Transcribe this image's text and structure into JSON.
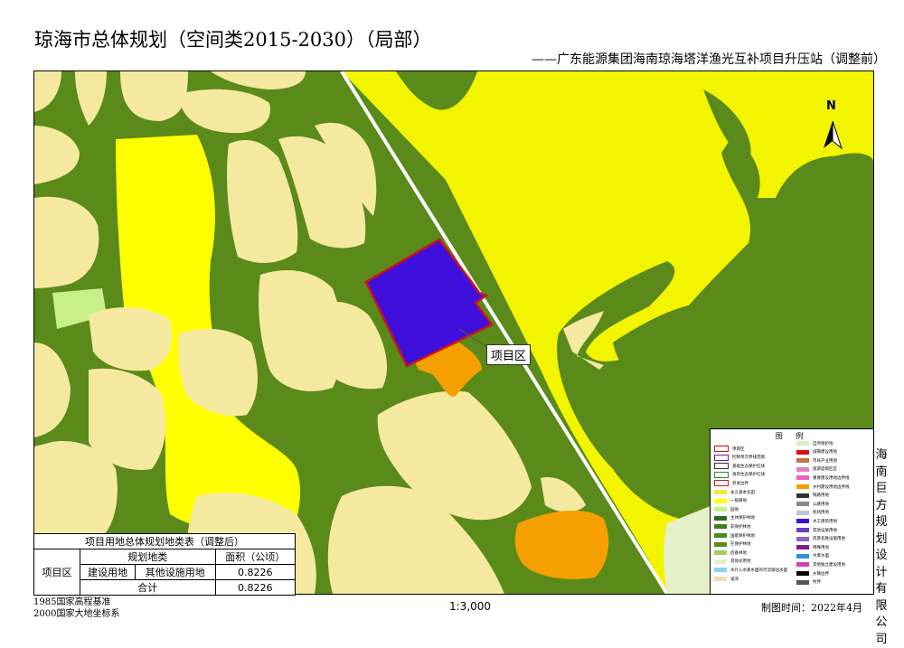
{
  "title": "琼海市总体规划（空间类2015-2030）（局部）",
  "subtitle": "——广东能源集团海南琼海塔洋渔光互补项目升压站（调整前）",
  "north_label": "N",
  "callout_label": "项目区",
  "company": "海南巨方规划设计有限公司",
  "datum_lines": [
    "1985国家高程基准",
    "2000国家大地坐标系"
  ],
  "scale": "1:3,000",
  "date": "制图时间：2022年4月",
  "table": {
    "title": "项目用地总体规划地类表（调整后）",
    "col_category": "规划地类",
    "col_area": "面积（公顷）",
    "row_header": "项目区",
    "rows": [
      {
        "cat1": "建设用地",
        "cat2": "其他设施用地",
        "area": "0.8226"
      }
    ],
    "total_label": "合计",
    "total_area": "0.8226"
  },
  "legend": {
    "title": "图 例",
    "left": [
      {
        "label": "项目区",
        "color": "#ffffff",
        "border": "#d0101a"
      },
      {
        "label": "控制单元界线范围",
        "color": "#ffffff",
        "border": "#6a1aa0"
      },
      {
        "label": "基础生态保护红线",
        "color": "#ffffff",
        "border": "#333333"
      },
      {
        "label": "海岸生态保护红线",
        "color": "#ffffff",
        "border": "#2a8a2a"
      },
      {
        "label": "开发边界",
        "color": "#ffffff",
        "border": "#c02020"
      },
      {
        "label": "永久基本农田",
        "color": "#f5e640"
      },
      {
        "label": "一般耕地",
        "color": "#ffff00"
      },
      {
        "label": "园地",
        "color": "#c8f08a"
      },
      {
        "label": "主体保护林地",
        "color": "#2f6b1a"
      },
      {
        "label": "非保护林地",
        "color": "#3f7d1f"
      },
      {
        "label": "国家保护林地",
        "color": "#4a8a22"
      },
      {
        "label": "在保护林地",
        "color": "#5a8a1a"
      },
      {
        "label": "后备林地",
        "color": "#9ed060"
      },
      {
        "label": "其他农用地",
        "color": "#e6f0c8"
      },
      {
        "label": "水计入水库水面的河流湖泊水面",
        "color": "#8fd0f0"
      },
      {
        "label": "滩涂",
        "color": "#f3dcb0"
      }
    ],
    "right": [
      {
        "label": "自然保护地",
        "color": "#d8f0c0"
      },
      {
        "label": "城镇建设用地",
        "color": "#e01010"
      },
      {
        "label": "市县产业用地",
        "color": "#b87a4a"
      },
      {
        "label": "旅游度假区区",
        "color": "#e080c0"
      },
      {
        "label": "重要建设用地边界线",
        "color": "#f060c0"
      },
      {
        "label": "乡村建设用地边界线",
        "color": "#f5a000"
      },
      {
        "label": "铁路用地",
        "color": "#333333"
      },
      {
        "label": "公路用地",
        "color": "#888888"
      },
      {
        "label": "机场用地",
        "color": "#b8c8e0"
      },
      {
        "label": "水工建筑用地",
        "color": "#3a10d0"
      },
      {
        "label": "其他设施用地",
        "color": "#6a40c0"
      },
      {
        "label": "风景名胜设施用地",
        "color": "#9060c0"
      },
      {
        "label": "特殊用地",
        "color": "#7a2080"
      },
      {
        "label": "水库水面",
        "color": "#3090e0"
      },
      {
        "label": "其他独立建设用地",
        "color": "#d040c0"
      },
      {
        "label": "乡镇边界",
        "color": "#000000"
      },
      {
        "label": "村界",
        "color": "#555555"
      }
    ]
  },
  "colors": {
    "forest": "#5a8a1a",
    "farmland": "#f5e9a0",
    "cropland_yellow": "#f3f400",
    "bright_yellow": "#ffff00",
    "project": "#3f10dc",
    "project_border": "#d0101a",
    "orange": "#f5a000",
    "light_green": "#e6f0c8",
    "pale_green": "#c8f08a"
  }
}
